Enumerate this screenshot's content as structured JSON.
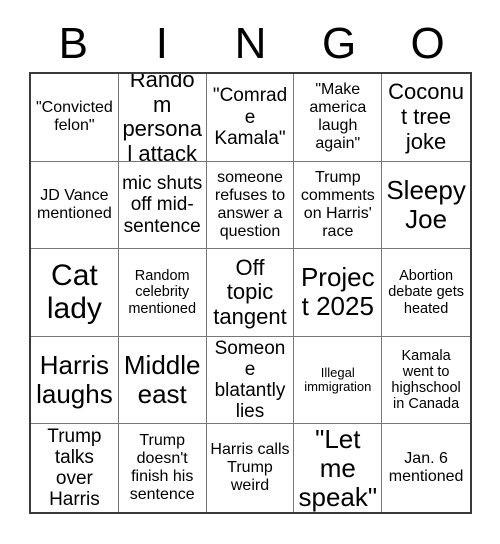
{
  "card": {
    "header_letters": [
      "B",
      "I",
      "N",
      "G",
      "O"
    ],
    "background_color": "#ffffff",
    "text_color": "#000000",
    "grid_border_color": "#3a3a3a",
    "grid_line_color": "#777777",
    "rows": 5,
    "columns": 5,
    "cells": [
      {
        "text": "\"Convicted felon\"",
        "size": "fs-md"
      },
      {
        "text": "Random personal attack",
        "size": "fs-xl"
      },
      {
        "text": "\"Comrade Kamala\"",
        "size": "fs-lg"
      },
      {
        "text": "\"Make america laugh again\"",
        "size": "fs-md"
      },
      {
        "text": "Coconut tree joke",
        "size": "fs-xl"
      },
      {
        "text": "JD Vance mentioned",
        "size": "fs-md"
      },
      {
        "text": "mic shuts off mid-sentence",
        "size": "fs-lg"
      },
      {
        "text": "someone refuses to answer a question",
        "size": "fs-md"
      },
      {
        "text": "Trump comments on Harris' race",
        "size": "fs-md"
      },
      {
        "text": "Sleepy Joe",
        "size": "fs-xxl"
      },
      {
        "text": "Cat lady",
        "size": "fs-huge"
      },
      {
        "text": "Random celebrity mentioned",
        "size": "fs-sm"
      },
      {
        "text": "Off topic tangent",
        "size": "fs-xl"
      },
      {
        "text": "Project 2025",
        "size": "fs-xxl"
      },
      {
        "text": "Abortion debate gets heated",
        "size": "fs-sm"
      },
      {
        "text": "Harris laughs",
        "size": "fs-xxl"
      },
      {
        "text": "Middle east",
        "size": "fs-xxl"
      },
      {
        "text": "Someone blatantly lies",
        "size": "fs-lg"
      },
      {
        "text": "Illegal immigration",
        "size": "fs-xs"
      },
      {
        "text": "Kamala went to highschool in Canada",
        "size": "fs-sm"
      },
      {
        "text": "Trump talks over Harris",
        "size": "fs-lg"
      },
      {
        "text": "Trump doesn't finish his sentence",
        "size": "fs-md"
      },
      {
        "text": "Harris calls Trump weird",
        "size": "fs-md"
      },
      {
        "text": "\"Let me speak\"",
        "size": "fs-xxl"
      },
      {
        "text": "Jan. 6 mentioned",
        "size": "fs-md"
      }
    ]
  }
}
